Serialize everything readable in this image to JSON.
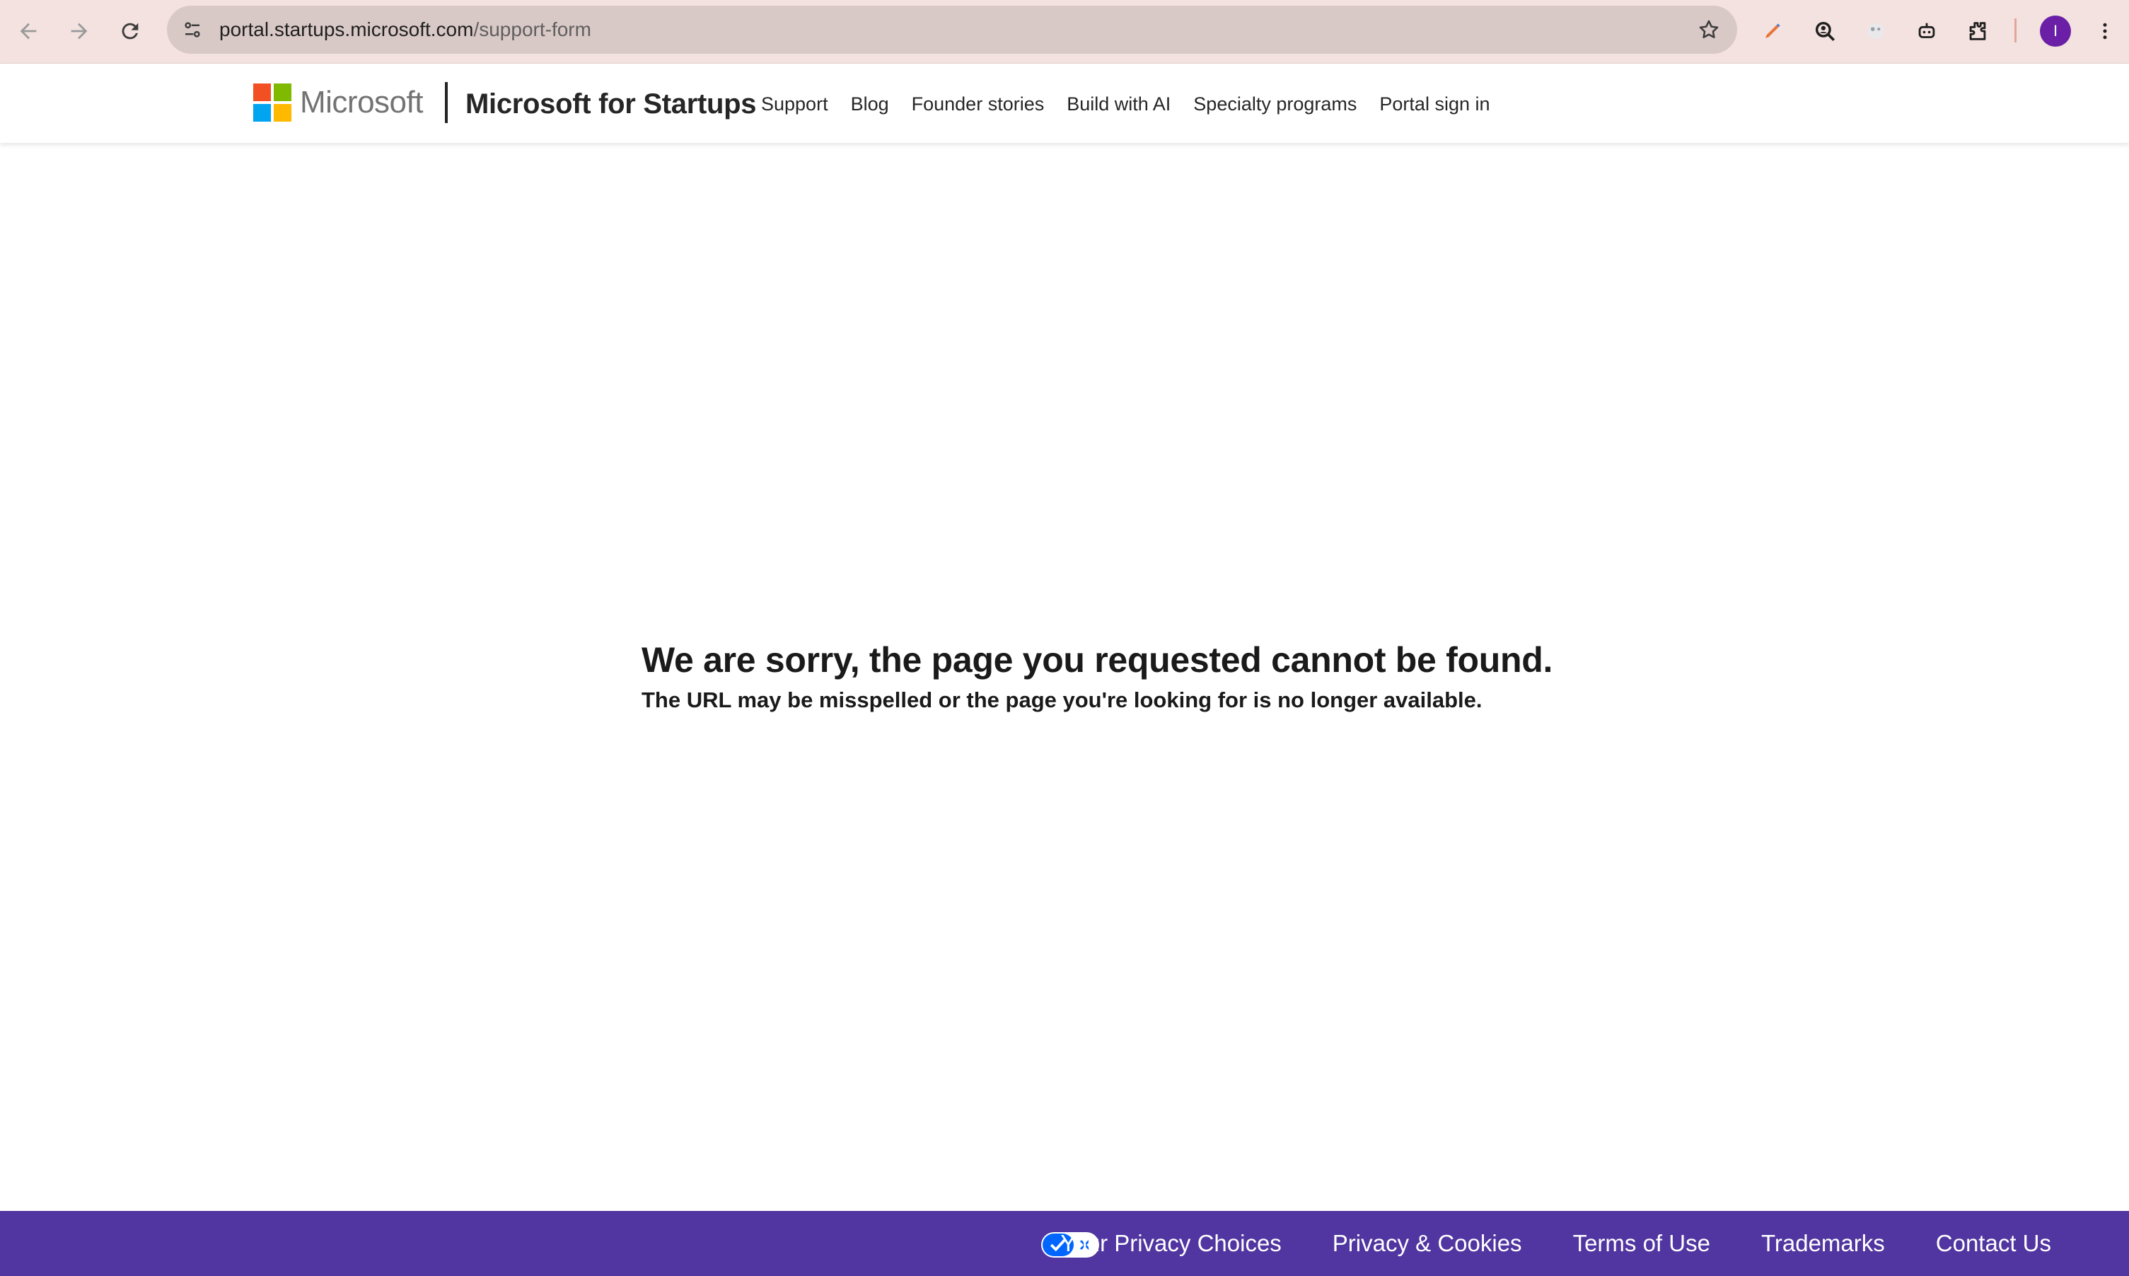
{
  "browser": {
    "url_host": "portal.startups.microsoft.com",
    "url_path": "/support-form",
    "profile_initial": "I",
    "icons": [
      "back-icon",
      "forward-icon",
      "reload-icon",
      "site-settings-icon",
      "star-icon",
      "pen-extension-icon",
      "zoom-lens-extension-icon",
      "eye-extension-icon",
      "robot-extension-icon",
      "puzzle-extensions-icon",
      "more-menu-icon"
    ]
  },
  "header": {
    "brand_word": "Microsoft",
    "product_name": "Microsoft for Startups",
    "nav": [
      "Support",
      "Blog",
      "Founder stories",
      "Build with AI",
      "Specialty programs",
      "Portal sign in"
    ]
  },
  "main": {
    "title": "We are sorry, the page you requested cannot be found.",
    "subtitle": "The URL may be misspelled or the page you're looking for is no longer available."
  },
  "footer": {
    "links": [
      "Your Privacy Choices",
      "Privacy & Cookies",
      "Terms of Use",
      "Trademarks",
      "Contact Us"
    ]
  },
  "colors": {
    "browser_bar": "#f3e2df",
    "footer_bg": "#5135a0",
    "ms_red": "#f25022",
    "ms_green": "#7fba00",
    "ms_blue": "#00a4ef",
    "ms_yellow": "#ffb900",
    "avatar": "#6a1fa6"
  }
}
